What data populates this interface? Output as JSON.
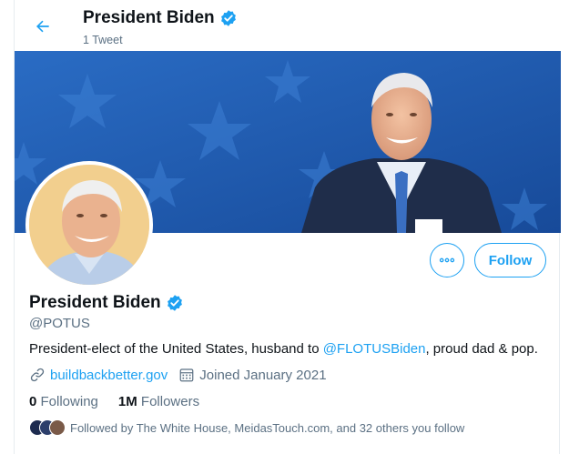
{
  "header": {
    "name": "President Biden",
    "tweet_count": "1 Tweet"
  },
  "profile": {
    "name": "President Biden",
    "handle": "@POTUS",
    "bio_prefix": "President-elect of the United States, husband to ",
    "bio_mention": "@FLOTUSBiden",
    "bio_suffix": ", proud dad & pop.",
    "website": "buildbackbetter.gov",
    "joined": "Joined January 2021",
    "following_count": "0",
    "following_label": "Following",
    "followers_count": "1M",
    "followers_label": "Followers",
    "followed_by": "Followed by The White House, MeidasTouch.com, and 32 others you follow"
  },
  "buttons": {
    "follow_label": "Follow",
    "more_label": "More"
  },
  "icons": {
    "back": "arrow-left-icon",
    "verified": "verified-badge-icon",
    "more": "more-dots-icon",
    "link": "link-icon",
    "calendar": "calendar-icon"
  },
  "colors": {
    "accent": "#1da1f2",
    "text": "#0f1419",
    "secondary": "#5b7083",
    "banner_blue": "#1e5bb0"
  }
}
